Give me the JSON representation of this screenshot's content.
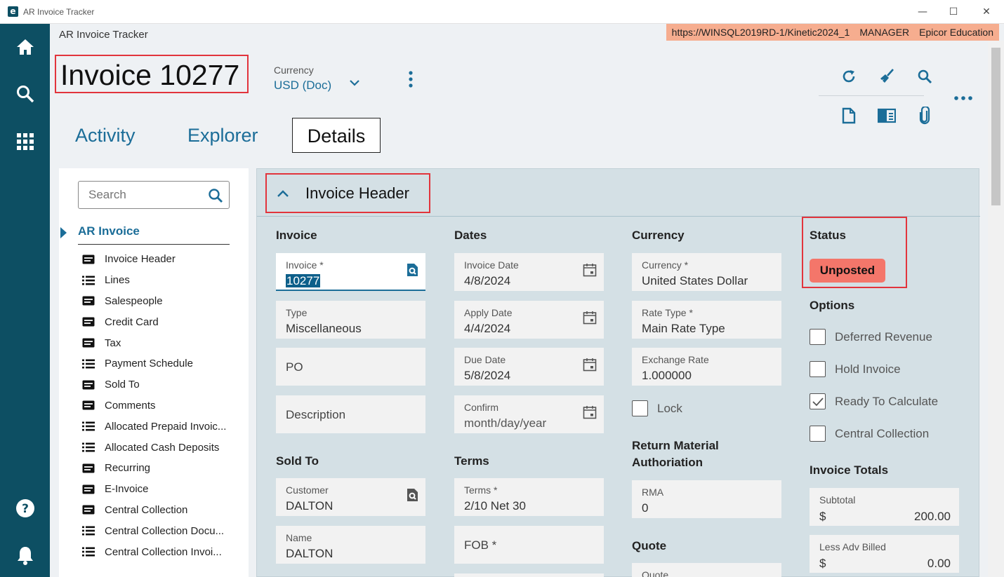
{
  "window": {
    "app_title": "AR Invoice Tracker",
    "controls": [
      "—",
      "☐",
      "✕"
    ]
  },
  "header": {
    "breadcrumb": "AR Invoice Tracker",
    "connection": {
      "url": "https://WINSQL2019RD-1/Kinetic2024_1",
      "user": "MANAGER",
      "company": "Epicor Education",
      "color": "#f6ad8f"
    },
    "page_title": "Invoice 10277",
    "currency": {
      "label": "Currency",
      "value": "USD (Doc)"
    }
  },
  "toolbar": {
    "icons": [
      "refresh-icon",
      "clear-icon",
      "search-icon",
      "new-page-icon",
      "layout-panel-icon",
      "attachment-icon",
      "more-icon"
    ]
  },
  "tabs": [
    {
      "label": "Activity",
      "active": false
    },
    {
      "label": "Explorer",
      "active": false
    },
    {
      "label": "Details",
      "active": true
    }
  ],
  "tree": {
    "search_placeholder": "Search",
    "root": "AR Invoice",
    "items": [
      {
        "label": "Invoice Header",
        "icon": "card-icon"
      },
      {
        "label": "Lines",
        "icon": "list-icon"
      },
      {
        "label": "Salespeople",
        "icon": "card-icon"
      },
      {
        "label": "Credit Card",
        "icon": "card-icon"
      },
      {
        "label": "Tax",
        "icon": "card-icon"
      },
      {
        "label": "Payment Schedule",
        "icon": "list-icon"
      },
      {
        "label": "Sold To",
        "icon": "card-icon"
      },
      {
        "label": "Comments",
        "icon": "card-icon"
      },
      {
        "label": "Allocated Prepaid Invoic...",
        "icon": "list-icon"
      },
      {
        "label": "Allocated Cash Deposits",
        "icon": "list-icon"
      },
      {
        "label": "Recurring",
        "icon": "card-icon"
      },
      {
        "label": "E-Invoice",
        "icon": "card-icon"
      },
      {
        "label": "Central Collection",
        "icon": "card-icon"
      },
      {
        "label": "Central Collection Docu...",
        "icon": "list-icon"
      },
      {
        "label": "Central Collection Invoi...",
        "icon": "list-icon"
      }
    ]
  },
  "card": {
    "title": "Invoice Header",
    "invoice": {
      "heading": "Invoice",
      "invoice_field": {
        "label": "Invoice *",
        "value": "10277"
      },
      "type_field": {
        "label": "Type",
        "value": "Miscellaneous"
      },
      "po_field": {
        "placeholder": "PO"
      },
      "description_field": {
        "placeholder": "Description"
      }
    },
    "sold_to": {
      "heading": "Sold To",
      "customer": {
        "label": "Customer",
        "value": "DALTON"
      },
      "name": {
        "label": "Name",
        "value": "DALTON"
      }
    },
    "dates": {
      "heading": "Dates",
      "invoice_date": {
        "label": "Invoice Date",
        "value": "4/8/2024"
      },
      "apply_date": {
        "label": "Apply Date",
        "value": "4/4/2024"
      },
      "due_date": {
        "label": "Due Date",
        "value": "5/8/2024"
      },
      "confirm": {
        "label": "Confirm",
        "value": "month/day/year"
      }
    },
    "terms": {
      "heading": "Terms",
      "terms_field": {
        "label": "Terms *",
        "value": "2/10 Net 30"
      },
      "fob_field": {
        "placeholder": "FOB *"
      }
    },
    "currency": {
      "heading": "Currency",
      "currency_field": {
        "label": "Currency *",
        "value": "United States Dollar"
      },
      "rate_type": {
        "label": "Rate Type *",
        "value": "Main Rate Type"
      },
      "exchange_rate": {
        "label": "Exchange Rate",
        "value": "1.000000"
      },
      "lock_label": "Lock"
    },
    "rma": {
      "heading_line1": "Return Material",
      "heading_line2": "Authoriation",
      "rma_field": {
        "label": "RMA",
        "value": "0"
      }
    },
    "quote": {
      "heading": "Quote",
      "quote_field": {
        "label": "Quote"
      }
    },
    "status": {
      "heading": "Status",
      "badge": "Unposted",
      "badge_color": "#f4766a"
    },
    "options": {
      "heading": "Options",
      "items": [
        {
          "label": "Deferred Revenue",
          "checked": false
        },
        {
          "label": "Hold Invoice",
          "checked": false
        },
        {
          "label": "Ready To Calculate",
          "checked": true
        },
        {
          "label": "Central Collection",
          "checked": false
        }
      ]
    },
    "totals": {
      "heading": "Invoice Totals",
      "subtotal": {
        "label": "Subtotal",
        "currency": "$",
        "amount": "200.00"
      },
      "less_adv_billed": {
        "label": "Less Adv Billed",
        "currency": "$",
        "amount": "0.00"
      }
    }
  },
  "colors": {
    "rail": "#0d4f63",
    "accent": "#1b6d98",
    "highlight_border": "#e2343c"
  }
}
